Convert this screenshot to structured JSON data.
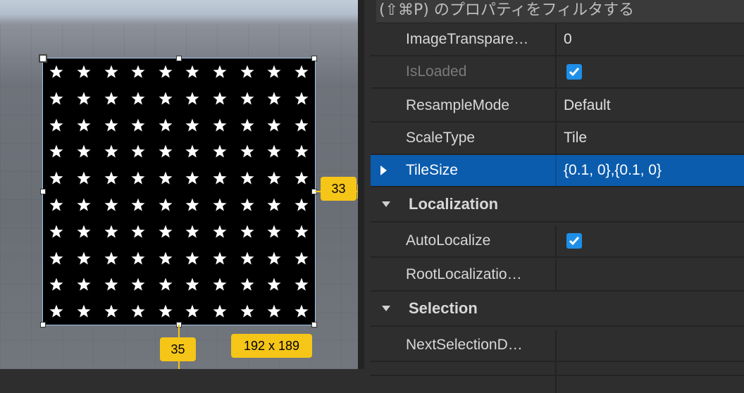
{
  "viewport": {
    "tile_columns": 10,
    "tile_rows": 10,
    "star_color": "#ffffff",
    "image_background": "#000000",
    "badges": {
      "right": "33",
      "bottom": "35",
      "size": "192 x 189"
    },
    "accent_color": "#f5c518"
  },
  "properties": {
    "filter_placeholder": "(⇧⌘P) のプロパティをフィルタする",
    "rows": {
      "image_transparency": {
        "name": "ImageTranspare…",
        "value": "0"
      },
      "is_loaded": {
        "name": "IsLoaded",
        "checked": true
      },
      "resample_mode": {
        "name": "ResampleMode",
        "value": "Default"
      },
      "scale_type": {
        "name": "ScaleType",
        "value": "Tile"
      },
      "tile_size": {
        "name": "TileSize",
        "value": "{0.1, 0},{0.1, 0}"
      },
      "auto_localize": {
        "name": "AutoLocalize",
        "checked": true
      },
      "root_localization": {
        "name": "RootLocalizatio…",
        "value": ""
      },
      "next_selection": {
        "name": "NextSelectionD…",
        "value": ""
      }
    },
    "sections": {
      "localization": "Localization",
      "selection": "Selection"
    },
    "selected_color": "#0b5cad",
    "checkbox_color": "#1e8fe8"
  }
}
